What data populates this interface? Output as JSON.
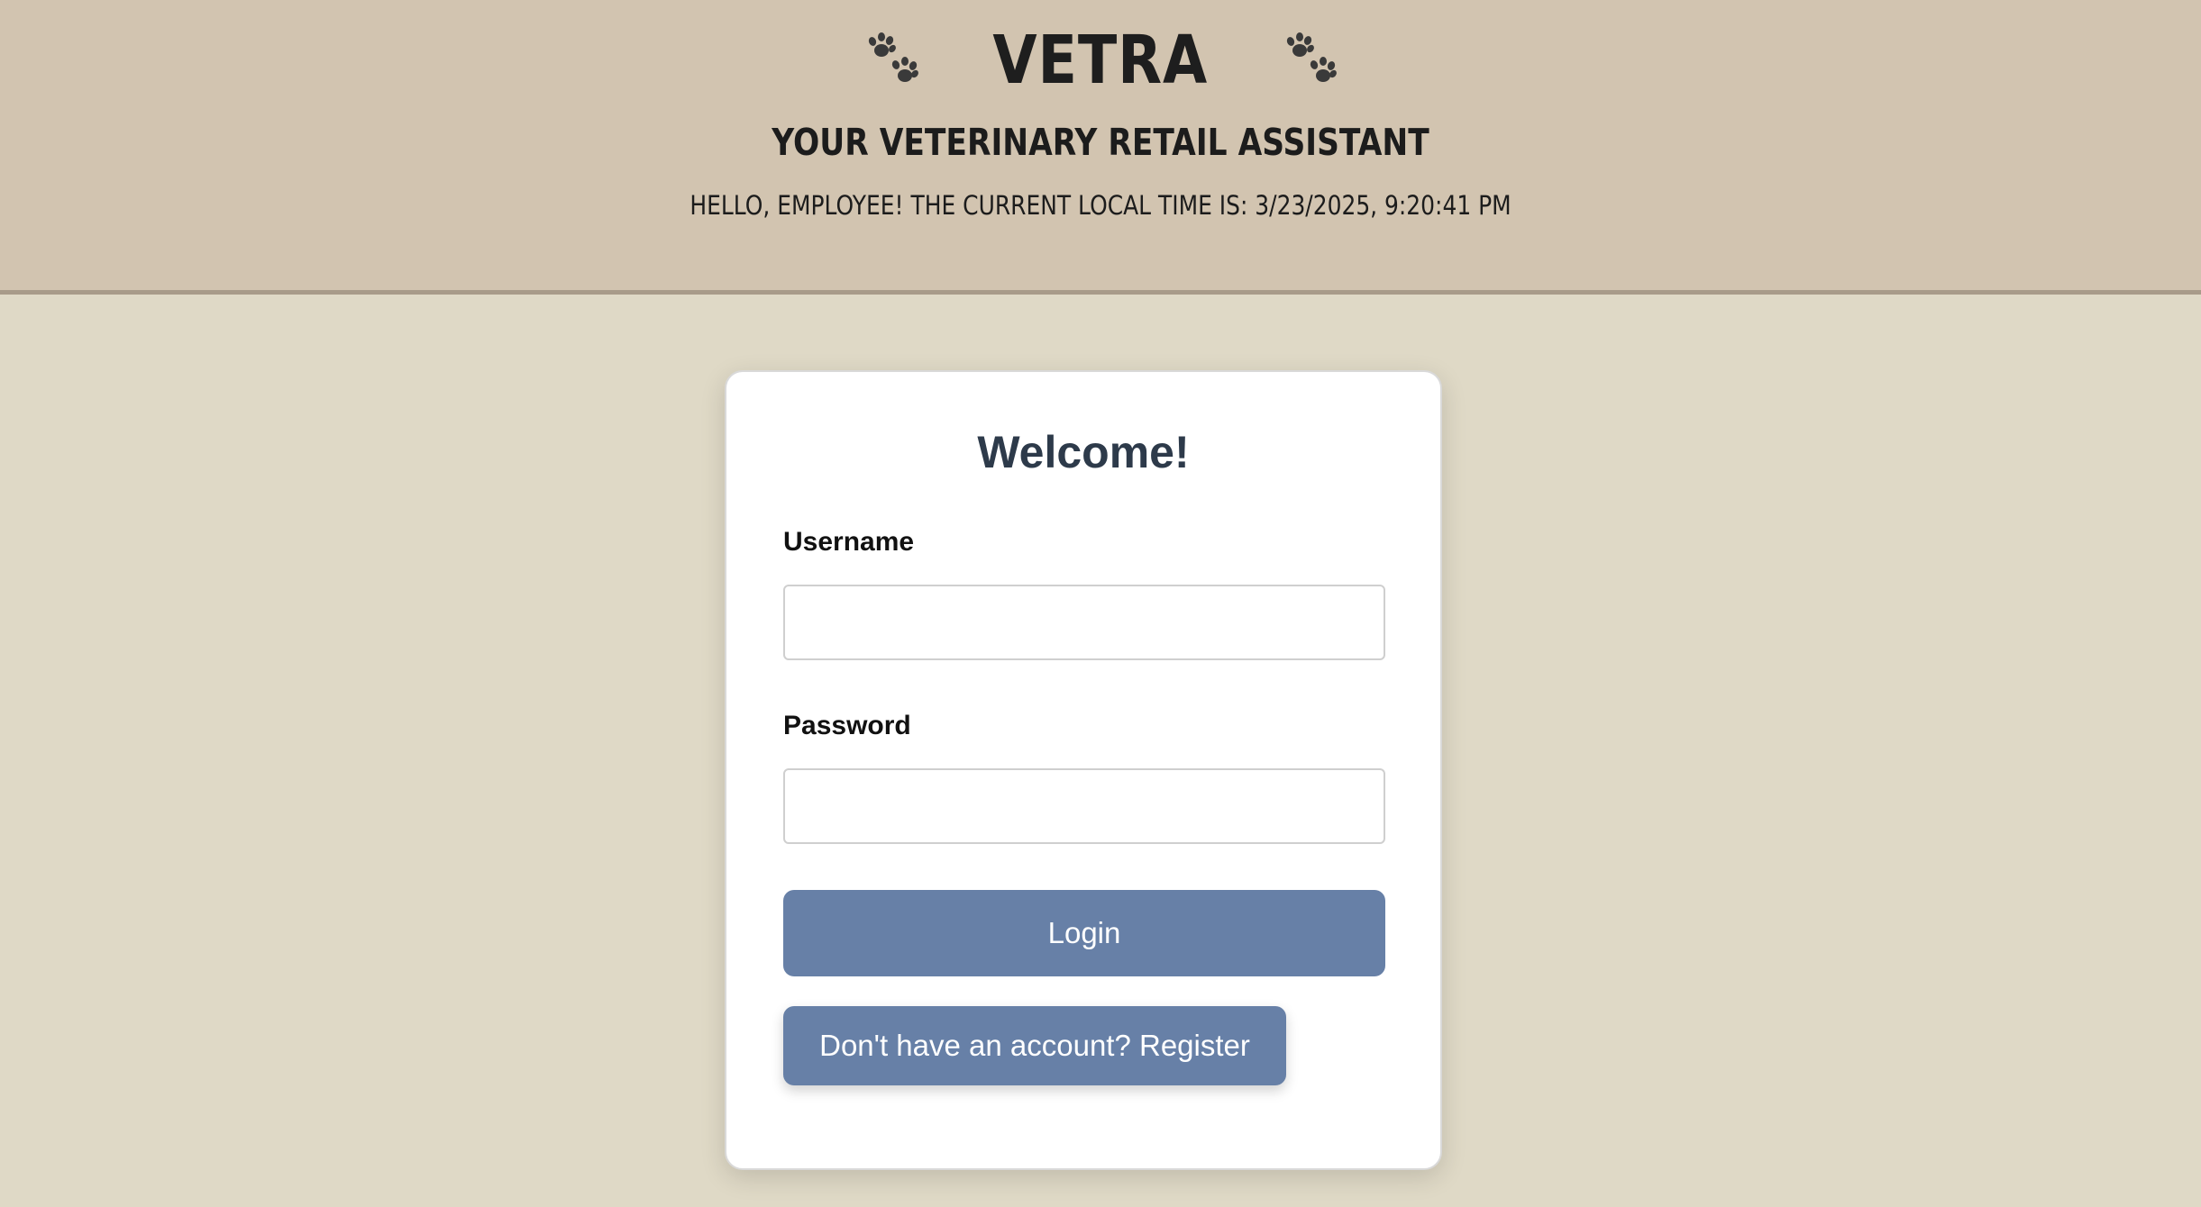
{
  "header": {
    "brand": "VETRA",
    "tagline": "YOUR VETERINARY RETAIL ASSISTANT",
    "greeting": "HELLO, EMPLOYEE! THE CURRENT LOCAL TIME IS: 3/23/2025, 9:20:41 PM",
    "icons": [
      "paw-prints-icon",
      "paw-prints-icon"
    ]
  },
  "login_card": {
    "heading": "Welcome!",
    "username_label": "Username",
    "username_value": "",
    "password_label": "Password",
    "password_value": "",
    "login_button": "Login",
    "register_button": "Don't have an account? Register"
  },
  "colors": {
    "page_background": "#dfd9c6",
    "header_background": "#d2c4b0",
    "header_border": "#a89b89",
    "button": "#6780a7",
    "heading_text": "#2d3a4a"
  }
}
